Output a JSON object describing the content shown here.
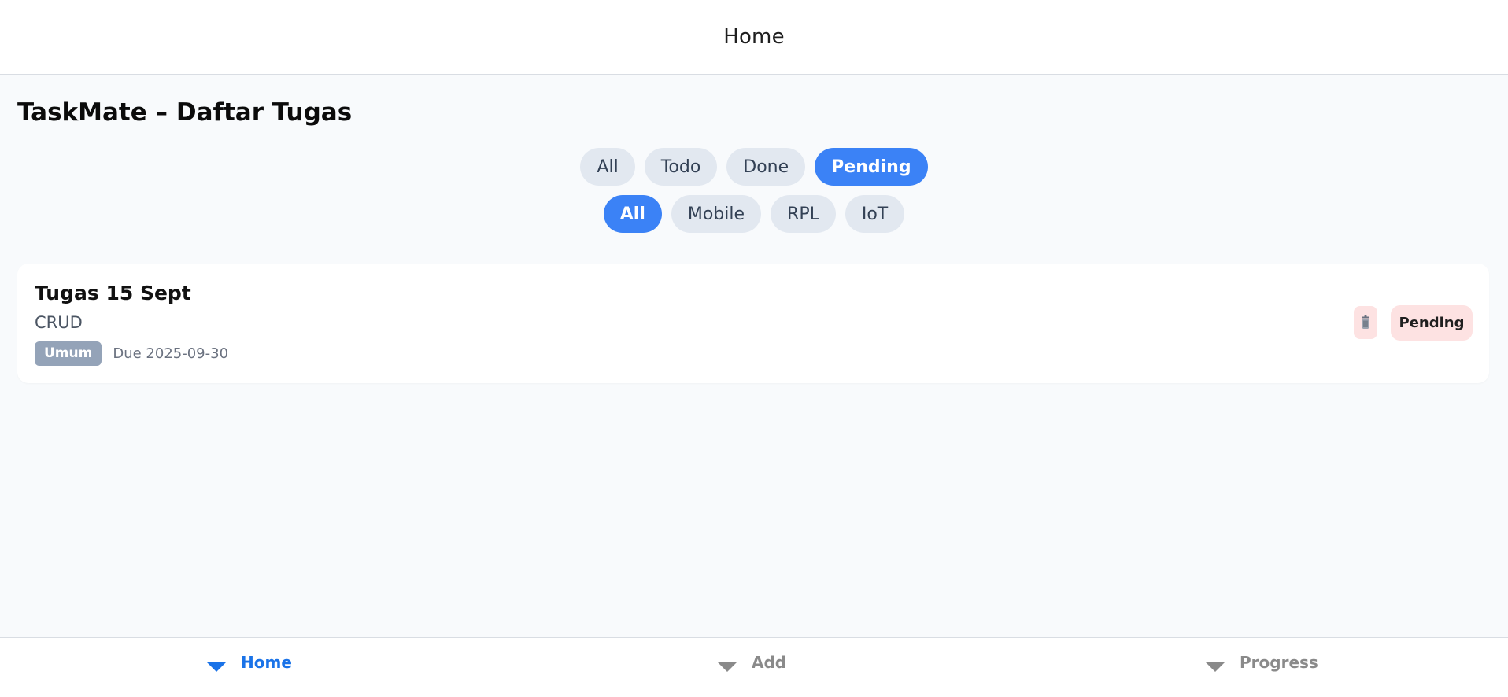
{
  "header": {
    "title": "Home"
  },
  "page": {
    "title": "TaskMate – Daftar Tugas"
  },
  "filters": {
    "status": [
      {
        "label": "All",
        "active": false
      },
      {
        "label": "Todo",
        "active": false
      },
      {
        "label": "Done",
        "active": false
      },
      {
        "label": "Pending",
        "active": true
      }
    ],
    "category": [
      {
        "label": "All",
        "active": true
      },
      {
        "label": "Mobile",
        "active": false
      },
      {
        "label": "RPL",
        "active": false
      },
      {
        "label": "IoT",
        "active": false
      }
    ]
  },
  "tasks": [
    {
      "title": "Tugas 15 Sept",
      "description": "CRUD",
      "tag": "Umum",
      "due": "Due 2025-09-30",
      "status": "Pending",
      "delete_icon": "trash-icon"
    }
  ],
  "nav": {
    "home": {
      "label": "Home",
      "icon": "caret-down-icon",
      "active": true
    },
    "add": {
      "label": "Add",
      "icon": "caret-down-icon",
      "active": false
    },
    "progress": {
      "label": "Progress",
      "icon": "caret-down-icon",
      "active": false
    }
  },
  "colors": {
    "accent": "#3b82f6",
    "nav_active": "#1a73e8",
    "chip_bg": "#e2e8f0",
    "pending_bg": "#fde2e2",
    "tag_bg": "#94a3b8"
  }
}
